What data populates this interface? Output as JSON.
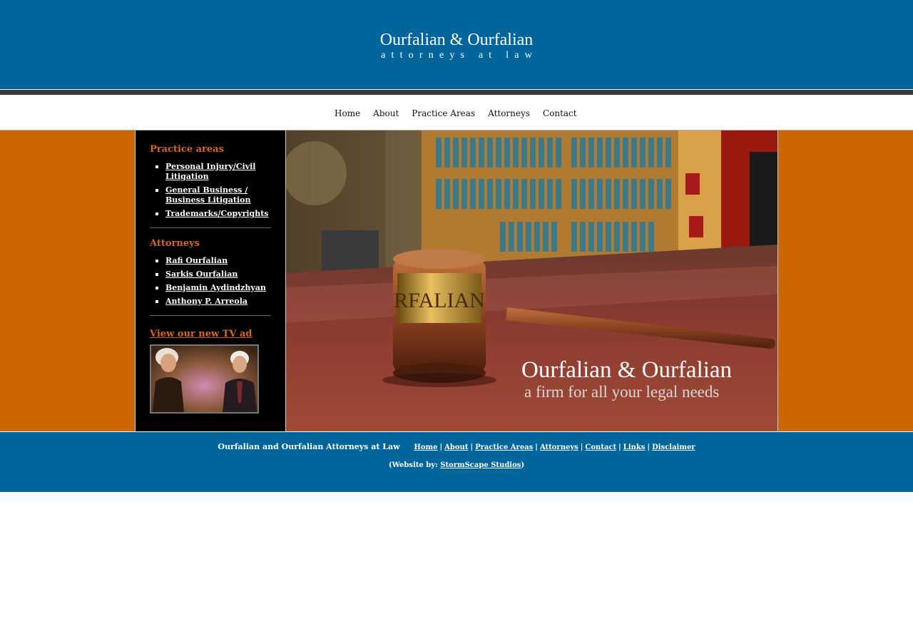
{
  "header": {
    "logo_name": "Ourfalian & Ourfalian",
    "logo_sub": "attorneys at law"
  },
  "nav": {
    "items": [
      "Home",
      "About",
      "Practice Areas",
      "Attorneys",
      "Contact"
    ]
  },
  "sidebar": {
    "practice_heading": "Practice areas",
    "practice_items": [
      "Personal Injury/Civil Litigation",
      "General Business / Business Litigation",
      "Trademarks/Copyrights"
    ],
    "attorneys_heading": "Attorneys",
    "attorney_items": [
      "Rafi Ourfalian",
      "Sarkis Ourfalian",
      "Benjamin Aydindzhyan",
      "Anthony P. Arreola"
    ],
    "tv_link": "View our new TV ad"
  },
  "hero": {
    "name": "Ourfalian & Ourfalian",
    "tagline": "a firm for all your legal needs",
    "gavel_plate": "RFALIAN"
  },
  "footer": {
    "company": "Ourfalian and Ourfalian Attorneys at Law",
    "links": [
      "Home",
      "About",
      "Practice Areas",
      "Attorneys",
      "Contact",
      "Links",
      "Disclaimer"
    ],
    "credit_prefix": "(Website by: ",
    "credit_link": "StormScape Studios",
    "credit_suffix": ")"
  },
  "colors": {
    "header_blue": "#00659b",
    "accent_orange": "#cc6600",
    "heading_orange": "#d2691e",
    "sidebar_black": "#000000"
  }
}
